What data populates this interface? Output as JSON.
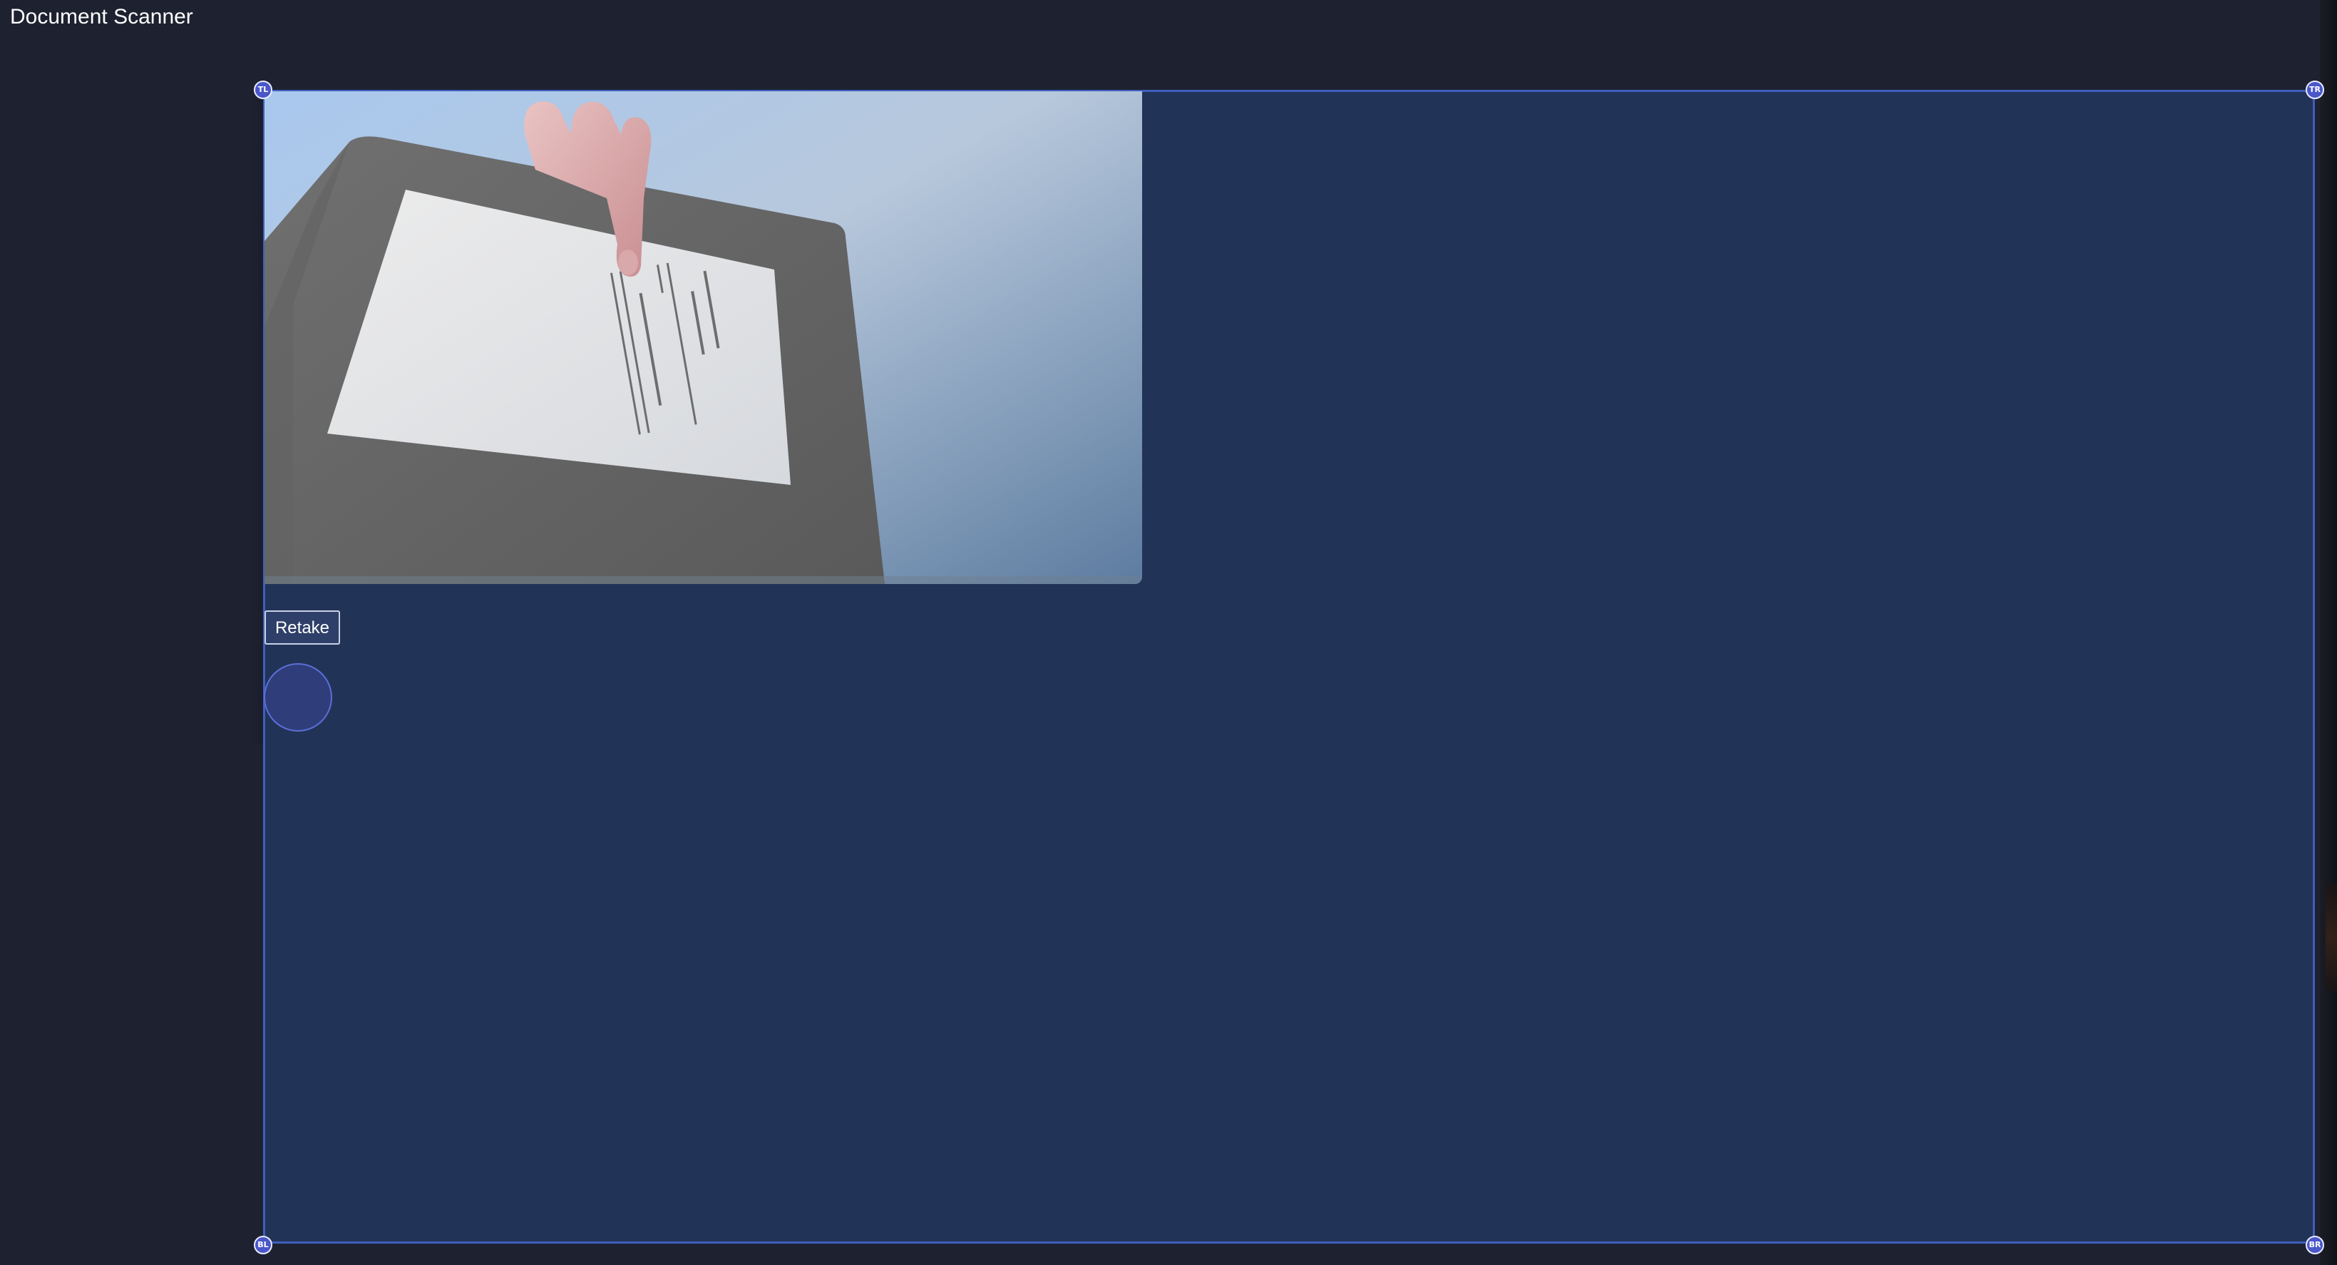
{
  "app": {
    "title": "Document Scanner"
  },
  "controls": {
    "retake_label": "Retake",
    "capture_icon": "capture-shutter-icon"
  },
  "crop_handles": {
    "top_left": "TL",
    "top_right": "TR",
    "bottom_left": "BL",
    "bottom_right": "BR"
  },
  "preview": {
    "description_icon": "camera-preview-image"
  },
  "colors": {
    "background": "#1e2130",
    "crop_area": "#223358",
    "crop_border": "#3f5fbf",
    "handle": "#4a56c9",
    "capture_button": "#2f3e7a"
  }
}
